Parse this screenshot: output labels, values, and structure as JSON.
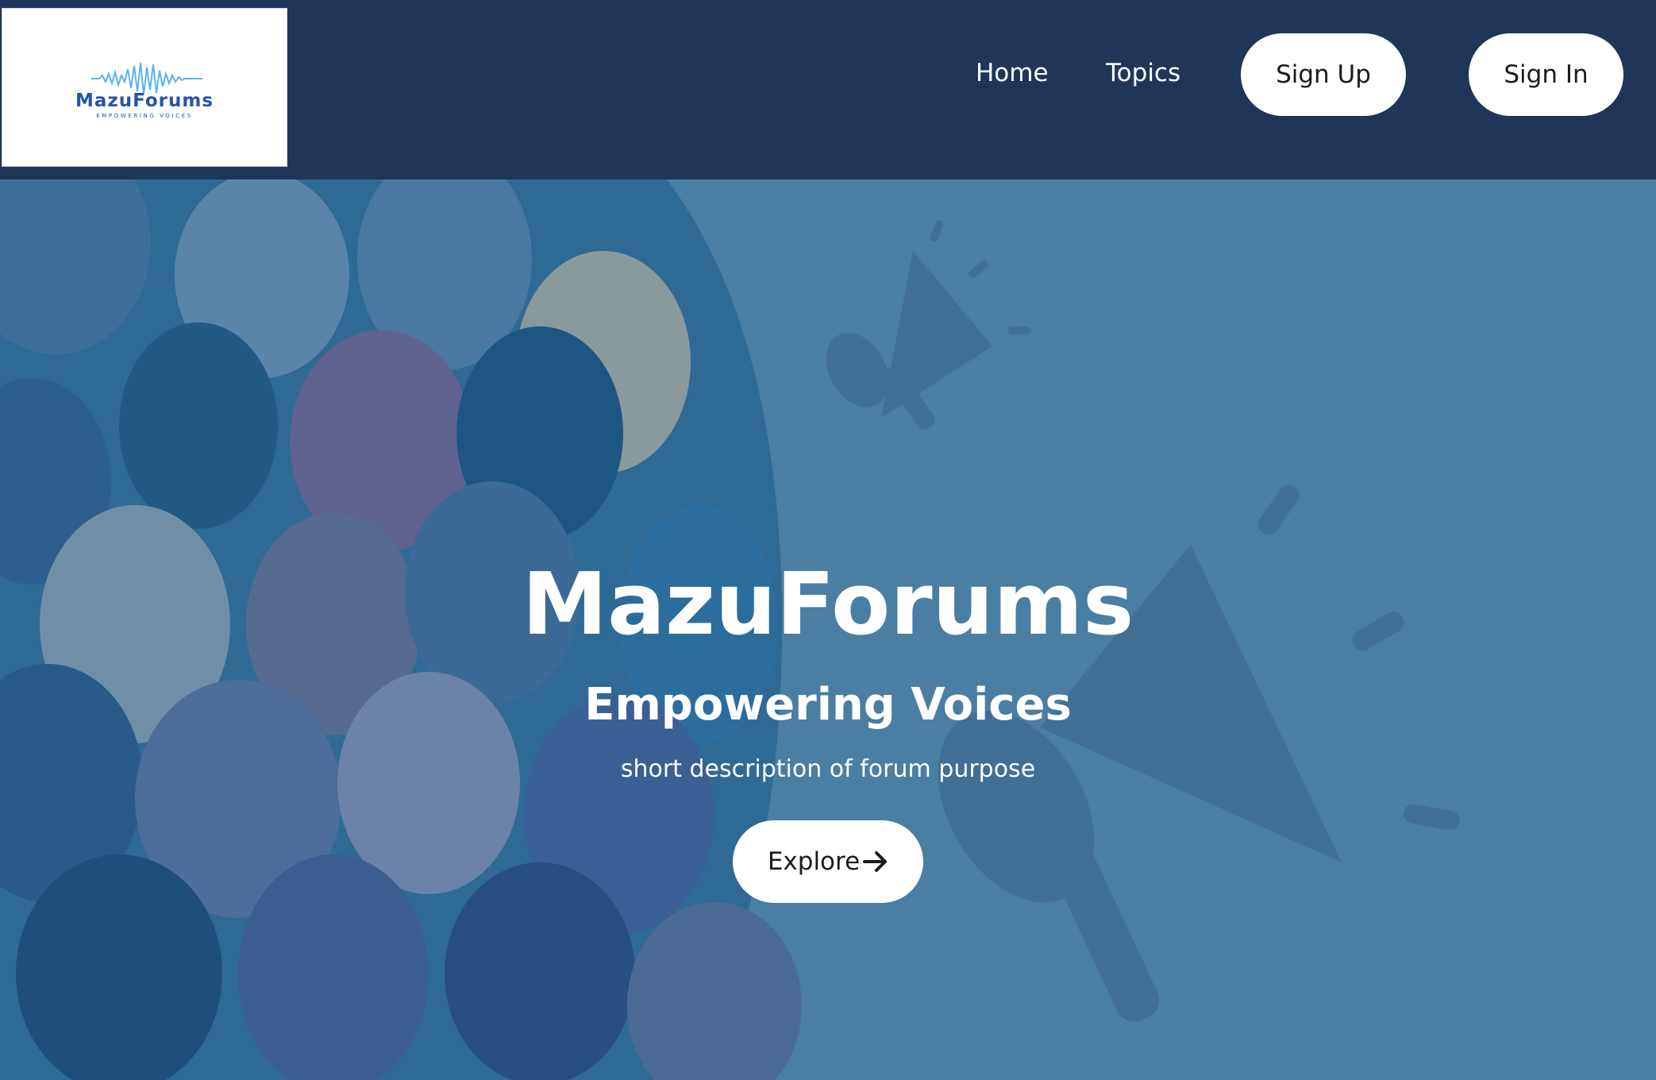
{
  "logo": {
    "name": "MazuForums",
    "tagline": "EMPOWERING VOICES"
  },
  "nav": {
    "home": "Home",
    "topics": "Topics",
    "sign_up": "Sign Up",
    "sign_in": "Sign In"
  },
  "hero": {
    "title": "MazuForums",
    "subtitle": "Empowering Voices",
    "description": "short description of forum purpose",
    "explore_label": "Explore",
    "explore_icon": "arrow-right-icon",
    "illustration": "crowd-silhouettes-and-megaphone"
  },
  "colors": {
    "navbar": "#1f3659",
    "hero_background": "#4a7ea2",
    "logo_text": "#2554a8",
    "logo_wave": "#5ab4ec",
    "button": "#ffffff"
  }
}
